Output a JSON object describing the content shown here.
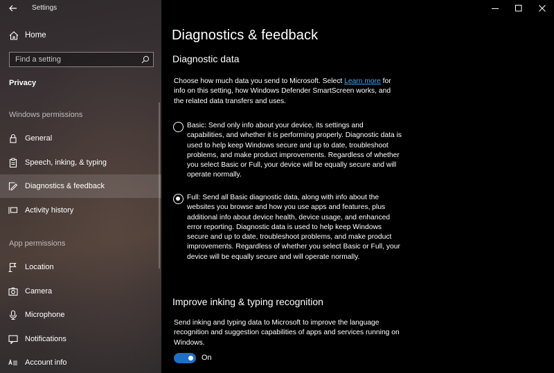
{
  "window": {
    "title": "Settings",
    "controls": [
      "minimize-icon",
      "maximize-icon",
      "close-icon"
    ]
  },
  "sidebar": {
    "home_label": "Home",
    "search_placeholder": "Find a setting",
    "section_title": "Privacy",
    "group_windows": "Windows permissions",
    "group_app": "App permissions",
    "items": [
      {
        "label": "General",
        "icon": "lock-icon",
        "selected": false
      },
      {
        "label": "Speech, inking, & typing",
        "icon": "clipboard-icon",
        "selected": false
      },
      {
        "label": "Diagnostics & feedback",
        "icon": "feedback-icon",
        "selected": true
      },
      {
        "label": "Activity history",
        "icon": "timeline-icon",
        "selected": false
      },
      {
        "label": "Location",
        "icon": "location-icon",
        "selected": false
      },
      {
        "label": "Camera",
        "icon": "camera-icon",
        "selected": false
      },
      {
        "label": "Microphone",
        "icon": "microphone-icon",
        "selected": false
      },
      {
        "label": "Notifications",
        "icon": "notifications-icon",
        "selected": false
      },
      {
        "label": "Account info",
        "icon": "account-info-icon",
        "selected": false
      }
    ]
  },
  "main": {
    "page_title": "Diagnostics & feedback",
    "diagnostic": {
      "heading": "Diagnostic data",
      "intro_before_link": "Choose how much data you send to Microsoft. Select ",
      "intro_link": "Learn more",
      "intro_after_link": " for info on this setting, how Windows Defender SmartScreen works, and the related data transfers and uses.",
      "options": [
        {
          "text": "Basic: Send only info about your device, its settings and capabilities, and whether it is performing properly. Diagnostic data is used to help keep Windows secure and up to date, troubleshoot problems, and make product improvements. Regardless of whether you select Basic or Full, your device will be equally secure and will operate normally.",
          "checked": false
        },
        {
          "text": "Full: Send all Basic diagnostic data, along with info about the websites you browse and how you use apps and features, plus additional info about device health, device usage, and enhanced error reporting. Diagnostic data is used to help keep Windows secure and up to date, troubleshoot problems, and make product improvements. Regardless of whether you select Basic or Full, your device will be equally secure and will operate normally.",
          "checked": true
        }
      ]
    },
    "inking": {
      "heading": "Improve inking & typing recognition",
      "description": "Send inking and typing data to Microsoft to improve the language recognition and suggestion capabilities of apps and services running on Windows.",
      "toggle_state": "On",
      "toggle_on": true
    }
  },
  "colors": {
    "accent": "#1f6fc5",
    "link": "#4aa3e8",
    "background": "#000000"
  }
}
